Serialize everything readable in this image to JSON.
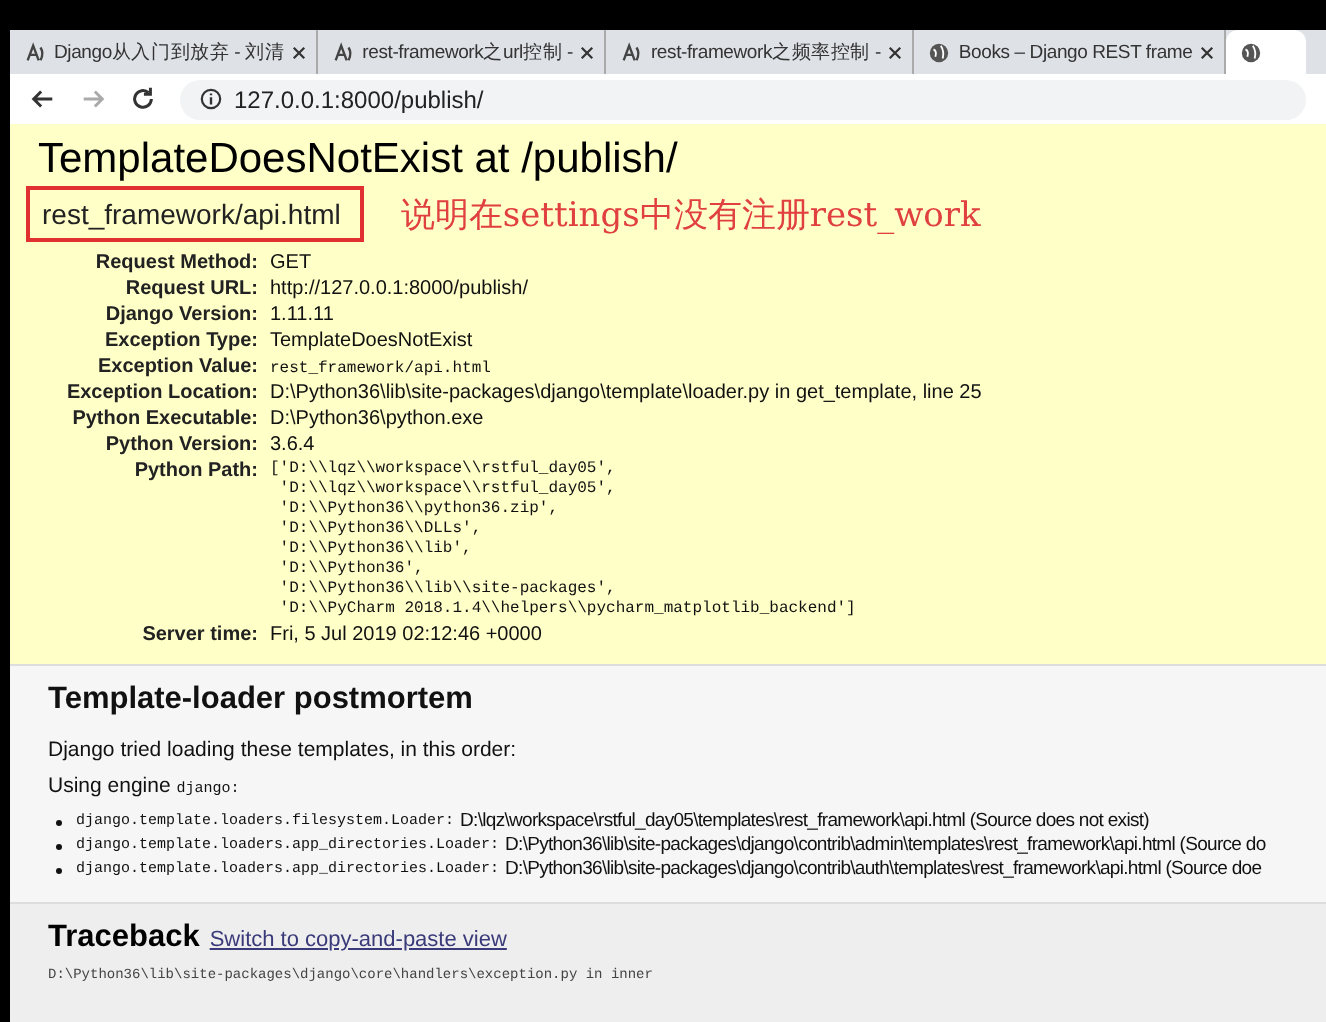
{
  "browser": {
    "tabs": [
      {
        "title": "Django从入门到放弃 - 刘清",
        "selected": false
      },
      {
        "title": "rest-framework之url控制 - ",
        "selected": false
      },
      {
        "title": "rest-framework之频率控制 -",
        "selected": false
      },
      {
        "title": "Books – Django REST frame",
        "selected": false
      },
      {
        "selected": true
      }
    ],
    "url": "127.0.0.1:8000/publish/"
  },
  "summary": {
    "title": "TemplateDoesNotExist at /publish/",
    "exception_value": "rest_framework/api.html",
    "annotation": "说明在settings中没有注册rest_work",
    "meta": [
      {
        "label": "Request Method:",
        "value": "GET",
        "kind": "text"
      },
      {
        "label": "Request URL:",
        "value": "http://127.0.0.1:8000/publish/",
        "kind": "text"
      },
      {
        "label": "Django Version:",
        "value": "1.11.11",
        "kind": "text"
      },
      {
        "label": "Exception Type:",
        "value": "TemplateDoesNotExist",
        "kind": "text"
      },
      {
        "label": "Exception Value:",
        "value": "rest_framework/api.html",
        "kind": "code"
      },
      {
        "label": "Exception Location:",
        "value": "D:\\Python36\\lib\\site-packages\\django\\template\\loader.py in get_template, line 25",
        "kind": "text"
      },
      {
        "label": "Python Executable:",
        "value": "D:\\Python36\\python.exe",
        "kind": "text"
      },
      {
        "label": "Python Version:",
        "value": "3.6.4",
        "kind": "text"
      },
      {
        "label": "Python Path:",
        "lines": [
          "['D:\\\\lqz\\\\workspace\\\\rstful_day05',",
          " 'D:\\\\lqz\\\\workspace\\\\rstful_day05',",
          " 'D:\\\\Python36\\\\python36.zip',",
          " 'D:\\\\Python36\\\\DLLs',",
          " 'D:\\\\Python36\\\\lib',",
          " 'D:\\\\Python36',",
          " 'D:\\\\Python36\\\\lib\\\\site-packages',",
          " 'D:\\\\PyCharm 2018.1.4\\\\helpers\\\\pycharm_matplotlib_backend']"
        ],
        "kind": "lines"
      },
      {
        "label": "Server time:",
        "value": "Fri, 5 Jul 2019 02:12:46 +0000",
        "kind": "text"
      }
    ]
  },
  "postmortem": {
    "title": "Template-loader postmortem",
    "intro": "Django tried loading these templates, in this order:",
    "engine_label": "Using engine",
    "engine": "django:",
    "loaders": [
      {
        "loader": "django.template.loaders.filesystem.Loader:",
        "path": "D:\\lqz\\workspace\\rstful_day05\\templates\\rest_framework\\api.html (Source does not exist)"
      },
      {
        "loader": "django.template.loaders.app_directories.Loader:",
        "path": "D:\\Python36\\lib\\site-packages\\django\\contrib\\admin\\templates\\rest_framework\\api.html (Source do"
      },
      {
        "loader": "django.template.loaders.app_directories.Loader:",
        "path": "D:\\Python36\\lib\\site-packages\\django\\contrib\\auth\\templates\\rest_framework\\api.html (Source doe"
      }
    ]
  },
  "traceback": {
    "title": "Traceback",
    "link": "Switch to copy-and-paste view",
    "frame": "D:\\Python36\\lib\\site-packages\\django\\core\\handlers\\exception.py in inner"
  }
}
